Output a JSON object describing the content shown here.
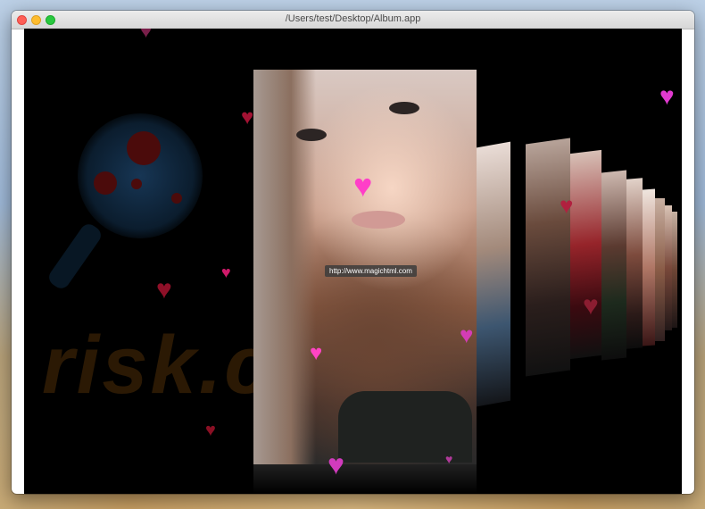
{
  "window": {
    "title": "/Users/test/Desktop/Album.app"
  },
  "overlay": {
    "url": "http://www.magichtml.com"
  },
  "watermark": {
    "text": "risk.com"
  },
  "colors": {
    "heart": "#ff3ec8",
    "background": "#000000"
  },
  "icons": [
    "close-icon",
    "minimize-icon",
    "maximize-icon",
    "heart-icon"
  ]
}
